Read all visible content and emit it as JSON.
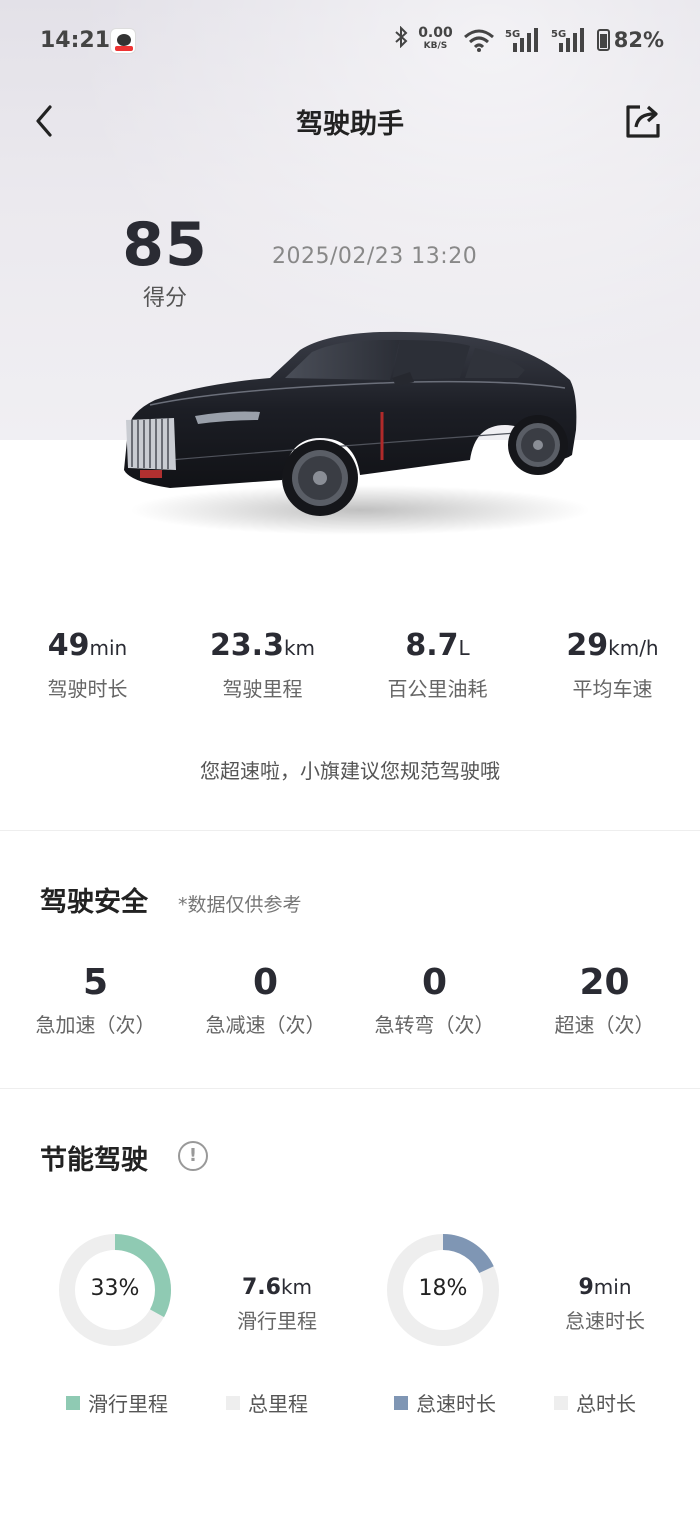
{
  "status_bar": {
    "time": "14:21",
    "net_speed_value": "0.00",
    "net_speed_unit": "KB/S",
    "battery": "82%",
    "icons": [
      "app-icon",
      "bluetooth-icon",
      "wifi-icon",
      "signal-5g-icon",
      "signal-5g-icon",
      "battery-icon"
    ]
  },
  "header": {
    "title": "驾驶助手",
    "back_icon": "chevron-left-icon",
    "share_icon": "share-icon"
  },
  "score": {
    "value": "85",
    "label": "得分",
    "datetime": "2025/02/23  13:20"
  },
  "stats": [
    {
      "value": "49",
      "unit": "min",
      "label": "驾驶时长"
    },
    {
      "value": "23.3",
      "unit": "km",
      "label": "驾驶里程"
    },
    {
      "value": "8.7",
      "unit": "L",
      "label": "百公里油耗"
    },
    {
      "value": "29",
      "unit": "km/h",
      "label": "平均车速"
    }
  ],
  "tip": "您超速啦，小旗建议您规范驾驶哦",
  "safety": {
    "title": "驾驶安全",
    "note": "*数据仅供参考",
    "items": [
      {
        "value": "5",
        "label": "急加速（次）"
      },
      {
        "value": "0",
        "label": "急减速（次）"
      },
      {
        "value": "0",
        "label": "急转弯（次）"
      },
      {
        "value": "20",
        "label": "超速（次）"
      }
    ]
  },
  "eco": {
    "title": "节能驾驶",
    "info_icon": "info-icon",
    "coast": {
      "percent": 33,
      "percent_label": "33%",
      "value": "7.6",
      "unit": "km",
      "label": "滑行里程",
      "color": "#8fcab3"
    },
    "idle": {
      "percent": 18,
      "percent_label": "18%",
      "value": "9",
      "unit": "min",
      "label": "怠速时长",
      "color": "#7f96b4"
    },
    "track_color": "#eeeeee",
    "legend": [
      {
        "label": "滑行里程",
        "color": "#8fcab3"
      },
      {
        "label": "总里程",
        "color": "#eeeeee"
      },
      {
        "label": "怠速时长",
        "color": "#7f96b4"
      },
      {
        "label": "总时长",
        "color": "#eeeeee"
      }
    ]
  }
}
